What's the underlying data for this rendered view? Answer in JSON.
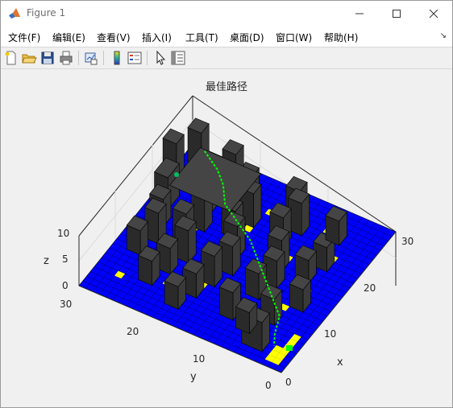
{
  "window": {
    "title": "Figure 1",
    "buttons": [
      "minimize",
      "maximize",
      "close"
    ]
  },
  "menubar": {
    "items": [
      "文件(F)",
      "编辑(E)",
      "查看(V)",
      "插入(I)",
      "工具(T)",
      "桌面(D)",
      "窗口(W)",
      "帮助(H)"
    ],
    "more": "↘"
  },
  "toolbar": {
    "icons": [
      "new-figure-icon",
      "open-file-icon",
      "save-icon",
      "print-icon",
      "link-plot-icon",
      "colorbar-icon",
      "legend-icon",
      "pointer-icon",
      "property-inspector-icon"
    ]
  },
  "figure": {
    "title": "最佳路径",
    "xlabel": "x",
    "ylabel": "y",
    "zlabel": "z",
    "x_ticks": [
      "0",
      "10",
      "20",
      "30"
    ],
    "y_ticks": [
      "0",
      "10",
      "20",
      "30"
    ],
    "z_ticks": [
      "0",
      "5",
      "10"
    ],
    "colors": {
      "floor": "#0000ff",
      "grid": "#000000",
      "obstacle": "#303030",
      "marker": "#ffff00",
      "path": "#00ff00"
    }
  }
}
